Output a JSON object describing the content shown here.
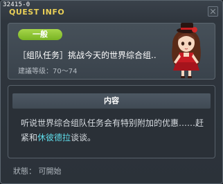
{
  "window": {
    "id_label": "32415-0",
    "title": "QUEST INFO"
  },
  "quest": {
    "badge": "一般",
    "name": "［组队任务］挑战今天的世界综合组..",
    "level_text": "建議等级：70～74"
  },
  "content": {
    "header": "内容",
    "text_before": "听说世界综合组队任务会有特别附加的优惠……赶紧和",
    "npc_name": "休彼德拉",
    "text_after": "谈谈。"
  },
  "status": "狀態： 可開始",
  "colors": {
    "title": "#e9cf57",
    "badge": "#8cc634",
    "npc_link": "#5fdcea"
  },
  "icons": {
    "npc": "npc-girl-illustration",
    "close": "close-icon"
  }
}
